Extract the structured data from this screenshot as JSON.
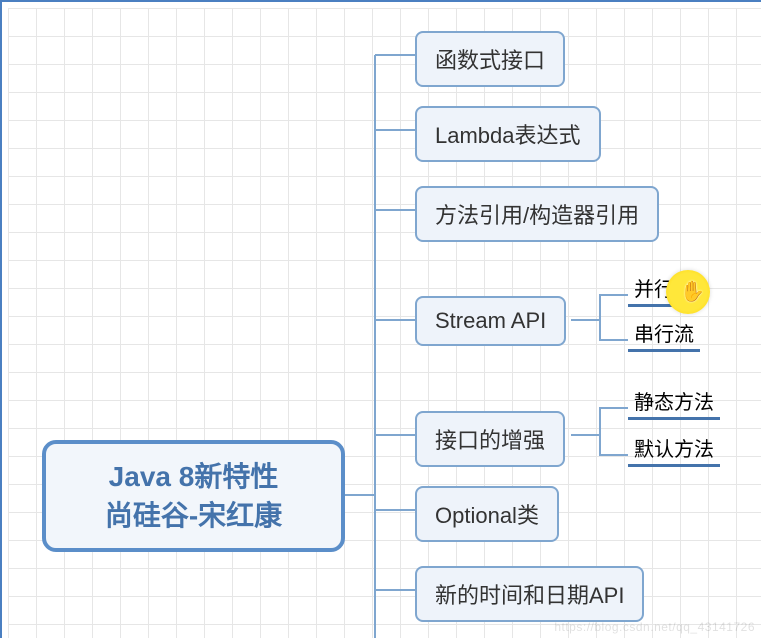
{
  "root": {
    "line1": "Java 8新特性",
    "line2": "尚硅谷-宋红康"
  },
  "nodes": {
    "n1": "函数式接口",
    "n2": "Lambda表达式",
    "n3": "方法引用/构造器引用",
    "n4": "Stream API",
    "n5": "接口的增强",
    "n6": "Optional类",
    "n7": "新的时间和日期API"
  },
  "leaves": {
    "l4a": "并行流",
    "l4b": "串行流",
    "l5a": "静态方法",
    "l5b": "默认方法"
  },
  "watermark": "https://blog.csdn.net/qq_43141726"
}
